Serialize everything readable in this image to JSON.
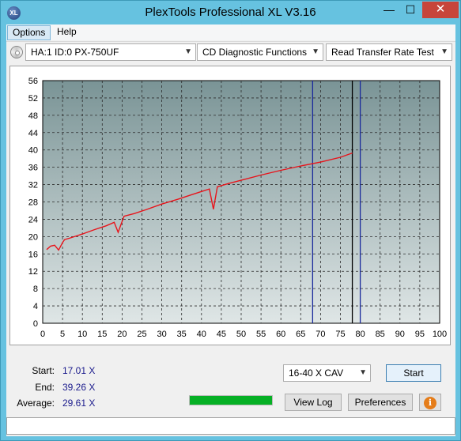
{
  "window": {
    "title": "PlexTools Professional XL V3.16",
    "icon_text": "XL",
    "minimize_glyph": "—",
    "maximize_glyph": "☐",
    "close_glyph": "✕"
  },
  "menu": {
    "items": [
      "Options",
      "Help"
    ],
    "active": "Options"
  },
  "toolbar": {
    "drive": "HA:1 ID:0  PX-750UF",
    "function": "CD Diagnostic Functions",
    "test": "Read Transfer Rate Test",
    "dropdown_icon": "chevron-down-icon"
  },
  "chart_data": {
    "type": "line",
    "xlim": [
      0,
      100
    ],
    "ylim": [
      0,
      56
    ],
    "x_ticks": [
      0,
      10,
      20,
      30,
      40,
      50,
      60,
      70,
      80,
      90,
      100
    ],
    "x_tick_labels": [
      "0",
      "5",
      "10",
      "15",
      "20",
      "25",
      "30",
      "35",
      "40",
      "45",
      "50",
      "55",
      "60",
      "65",
      "70",
      "75",
      "80",
      "85",
      "90",
      "95",
      "100"
    ],
    "x_tick_positions": [
      0,
      5,
      10,
      15,
      20,
      25,
      30,
      35,
      40,
      45,
      50,
      55,
      60,
      65,
      70,
      75,
      80,
      85,
      90,
      95,
      100
    ],
    "y_ticks": [
      0,
      4,
      8,
      12,
      16,
      20,
      24,
      28,
      32,
      36,
      40,
      44,
      48,
      52,
      56
    ],
    "grid": true,
    "colors": {
      "line": "#e8141b",
      "marker_blue": "#1a2a9c",
      "marker_black": "#000000",
      "plot_bg_top": "#7a9496",
      "plot_bg_bottom": "#dfe6e6",
      "grid": "#2b2b2b"
    },
    "vertical_markers": [
      {
        "x": 68,
        "color": "blue"
      },
      {
        "x": 78,
        "color": "black"
      },
      {
        "x": 80,
        "color": "blue"
      }
    ],
    "series": [
      {
        "values": [
          [
            1,
            17.0
          ],
          [
            2,
            17.8
          ],
          [
            3,
            18.0
          ],
          [
            4,
            16.9
          ],
          [
            5,
            18.6
          ],
          [
            5.5,
            19.3
          ],
          [
            7,
            19.7
          ],
          [
            10,
            20.6
          ],
          [
            13,
            21.6
          ],
          [
            16,
            22.5
          ],
          [
            18,
            23.3
          ],
          [
            19,
            21.0
          ],
          [
            20,
            23.5
          ],
          [
            20.5,
            24.7
          ],
          [
            23,
            25.3
          ],
          [
            26,
            26.2
          ],
          [
            30,
            27.5
          ],
          [
            34,
            28.6
          ],
          [
            38,
            29.8
          ],
          [
            42,
            31.0
          ],
          [
            43,
            26.3
          ],
          [
            44,
            31.5
          ],
          [
            47,
            32.3
          ],
          [
            50,
            33.0
          ],
          [
            55,
            34.2
          ],
          [
            60,
            35.3
          ],
          [
            65,
            36.3
          ],
          [
            70,
            37.2
          ],
          [
            75,
            38.3
          ],
          [
            78,
            39.3
          ]
        ]
      }
    ]
  },
  "stats": {
    "start_label": "Start:",
    "start_value": "17.01",
    "end_label": "End:",
    "end_value": "39.26",
    "average_label": "Average:",
    "average_value": "29.61",
    "unit_glyph": "X"
  },
  "controls": {
    "speed": "16-40 X CAV",
    "start_label": "Start",
    "viewlog_label": "View Log",
    "prefs_label": "Preferences",
    "info_glyph": "i",
    "progress": 1.0
  },
  "status": {
    "text": ""
  }
}
